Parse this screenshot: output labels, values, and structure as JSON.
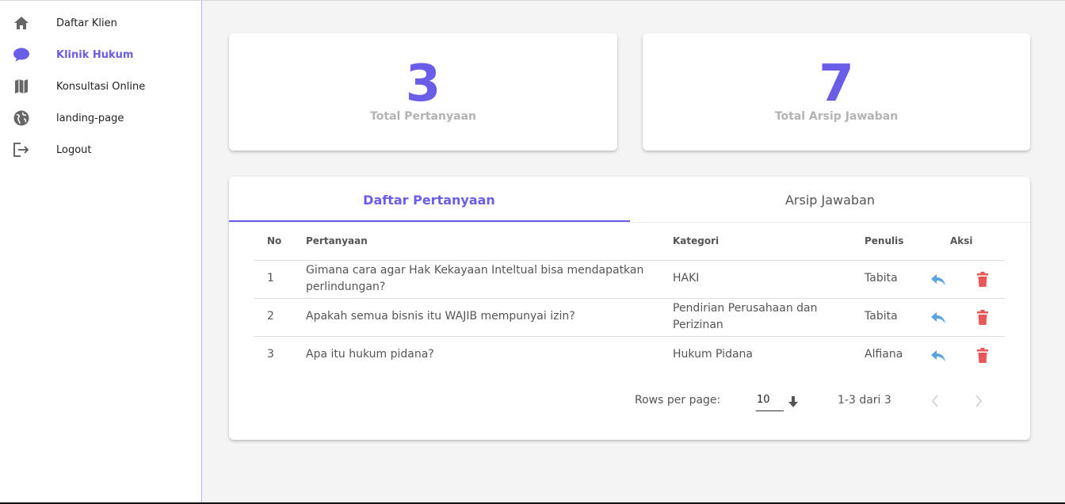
{
  "colors": {
    "accent": "#6a5de8",
    "reply": "#5ba3e0",
    "delete": "#ea5555",
    "muted": "#b3b3b3"
  },
  "sidebar": {
    "items": [
      {
        "label": "Daftar Klien",
        "icon": "home-icon"
      },
      {
        "label": "Klinik Hukum",
        "icon": "chat-bubble-icon",
        "active": true
      },
      {
        "label": "Konsultasi Online",
        "icon": "map-icon"
      },
      {
        "label": "landing-page",
        "icon": "globe-icon"
      },
      {
        "label": "Logout",
        "icon": "logout-icon"
      }
    ]
  },
  "stats": [
    {
      "value": "3",
      "label": "Total Pertanyaan"
    },
    {
      "value": "7",
      "label": "Total Arsip Jawaban"
    }
  ],
  "tabs": [
    {
      "label": "Daftar Pertanyaan",
      "active": true
    },
    {
      "label": "Arsip Jawaban"
    }
  ],
  "table": {
    "columns": [
      "No",
      "Pertanyaan",
      "Kategori",
      "Penulis",
      "Aksi"
    ],
    "rows": [
      {
        "no": "1",
        "pertanyaan": "Gimana cara agar Hak Kekayaan Inteltual bisa mendapatkan perlindungan?",
        "kategori": "HAKI",
        "penulis": "Tabita"
      },
      {
        "no": "2",
        "pertanyaan": "Apakah semua bisnis itu WAJIB mempunyai izin?",
        "kategori": "Pendirian Perusahaan dan Perizinan",
        "penulis": "Tabita"
      },
      {
        "no": "3",
        "pertanyaan": "Apa itu hukum pidana?",
        "kategori": "Hukum Pidana",
        "penulis": "Alfiana"
      }
    ],
    "actions": {
      "reply_icon": "reply-icon",
      "delete_icon": "trash-icon"
    }
  },
  "pagination": {
    "rows_per_page_label": "Rows per page:",
    "rows_per_page_value": "10",
    "range_text": "1-3 dari 3"
  }
}
